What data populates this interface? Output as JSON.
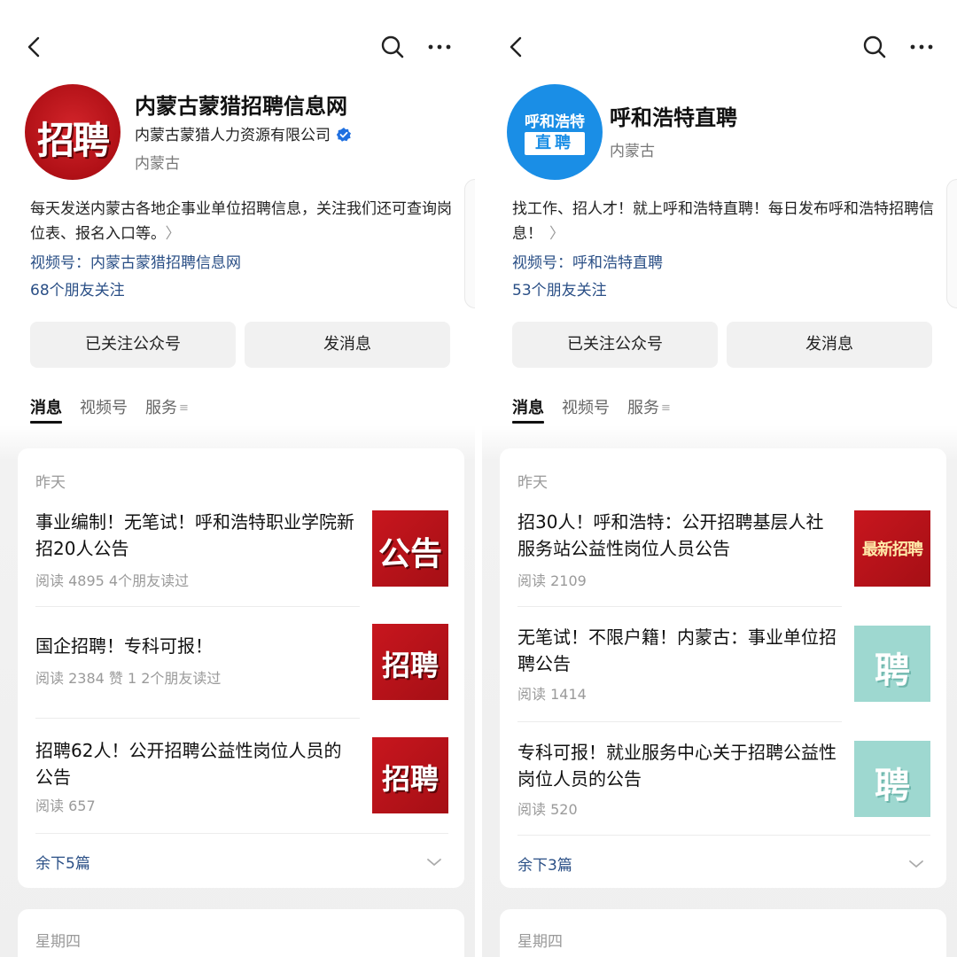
{
  "left": {
    "account": {
      "name": "内蒙古蒙猎招聘信息网",
      "company": "内蒙古蒙猎人力资源有限公司",
      "region": "内蒙古",
      "avatar_text": "招聘",
      "description": "每天发送内蒙古各地企事业单位招聘信息，关注我们还可查询岗位表、报名入口等。",
      "channel": "视频号：内蒙古蒙猎招聘信息网",
      "friends": "68个朋友关注"
    },
    "buttons": {
      "follow": "已关注公众号",
      "message": "发消息"
    },
    "tabs": [
      {
        "label": "消息"
      },
      {
        "label": "视频号"
      },
      {
        "label": "服务"
      }
    ],
    "feed": {
      "day": "昨天",
      "articles": [
        {
          "title": "事业编制！无笔试！呼和浩特职业学院新招20人公告",
          "meta": "阅读 4895   4个朋友读过",
          "thumb_text": "公告"
        },
        {
          "title": "国企招聘！专科可报！",
          "meta": "阅读 2384   赞 1   2个朋友读过",
          "thumb_text": "招聘"
        },
        {
          "title": "招聘62人！公开招聘公益性岗位人员的公告",
          "meta": "阅读 657",
          "thumb_text": "招聘"
        }
      ],
      "more": "余下5篇",
      "next_day": "星期四"
    }
  },
  "right": {
    "account": {
      "name": "呼和浩特直聘",
      "region": "内蒙古",
      "avatar_top": "呼和浩特",
      "avatar_box": "直聘",
      "description": "找工作、招人才！就上呼和浩特直聘！每日发布呼和浩特招聘信息！",
      "channel": "视频号：呼和浩特直聘",
      "friends": "53个朋友关注"
    },
    "buttons": {
      "follow": "已关注公众号",
      "message": "发消息"
    },
    "tabs": [
      {
        "label": "消息"
      },
      {
        "label": "视频号"
      },
      {
        "label": "服务"
      }
    ],
    "feed": {
      "day": "昨天",
      "articles": [
        {
          "title": "招30人！呼和浩特：公开招聘基层人社服务站公益性岗位人员公告",
          "meta": "阅读 2109",
          "thumb_text": "最新招聘"
        },
        {
          "title": "无笔试！不限户籍！内蒙古：事业单位招聘公告",
          "meta": "阅读 1414",
          "thumb_text": "聘"
        },
        {
          "title": "专科可报！就业服务中心关于招聘公益性岗位人员的公告",
          "meta": "阅读 520",
          "thumb_text": "聘"
        }
      ],
      "more": "余下3篇",
      "next_day": "星期四"
    }
  },
  "colors": {
    "link_blue": "#2a4f86",
    "verified_blue": "#1e6fe0",
    "thumb_red": "#c8161e",
    "thumb_teal": "#9ed8d0"
  }
}
